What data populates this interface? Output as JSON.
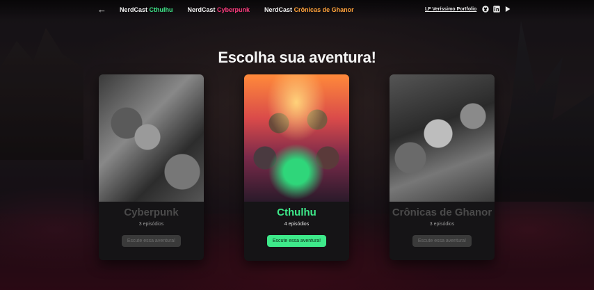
{
  "nav": {
    "back_icon": "←",
    "links": [
      {
        "prefix": "NerdCast ",
        "accent": "Cthulhu",
        "accent_color": "#3ee98a"
      },
      {
        "prefix": "NerdCast ",
        "accent": "Cyberpunk",
        "accent_color": "#ff3b7f"
      },
      {
        "prefix": "NerdCast ",
        "accent": "Crônicas de Ghanor",
        "accent_color": "#ffa23a"
      }
    ],
    "portfolio_label": "LF Veríssimo Portfolio",
    "icons": [
      "github-icon",
      "linkedin-icon",
      "play-store-icon"
    ]
  },
  "title": "Escolha sua aventura!",
  "cards": [
    {
      "name": "Cyberpunk",
      "episodes": "3 episódios",
      "button": "Escute essa aventura!",
      "active": false
    },
    {
      "name": "Cthulhu",
      "episodes": "4 episódios",
      "button": "Escute essa aventura!",
      "active": true
    },
    {
      "name": "Crônicas de Ghanor",
      "episodes": "3 episódios",
      "button": "Escute essa aventura!",
      "active": false
    }
  ],
  "colors": {
    "green": "#3ee98a",
    "pink": "#ff3b7f",
    "orange": "#ffa23a",
    "card_bg": "#151416"
  }
}
